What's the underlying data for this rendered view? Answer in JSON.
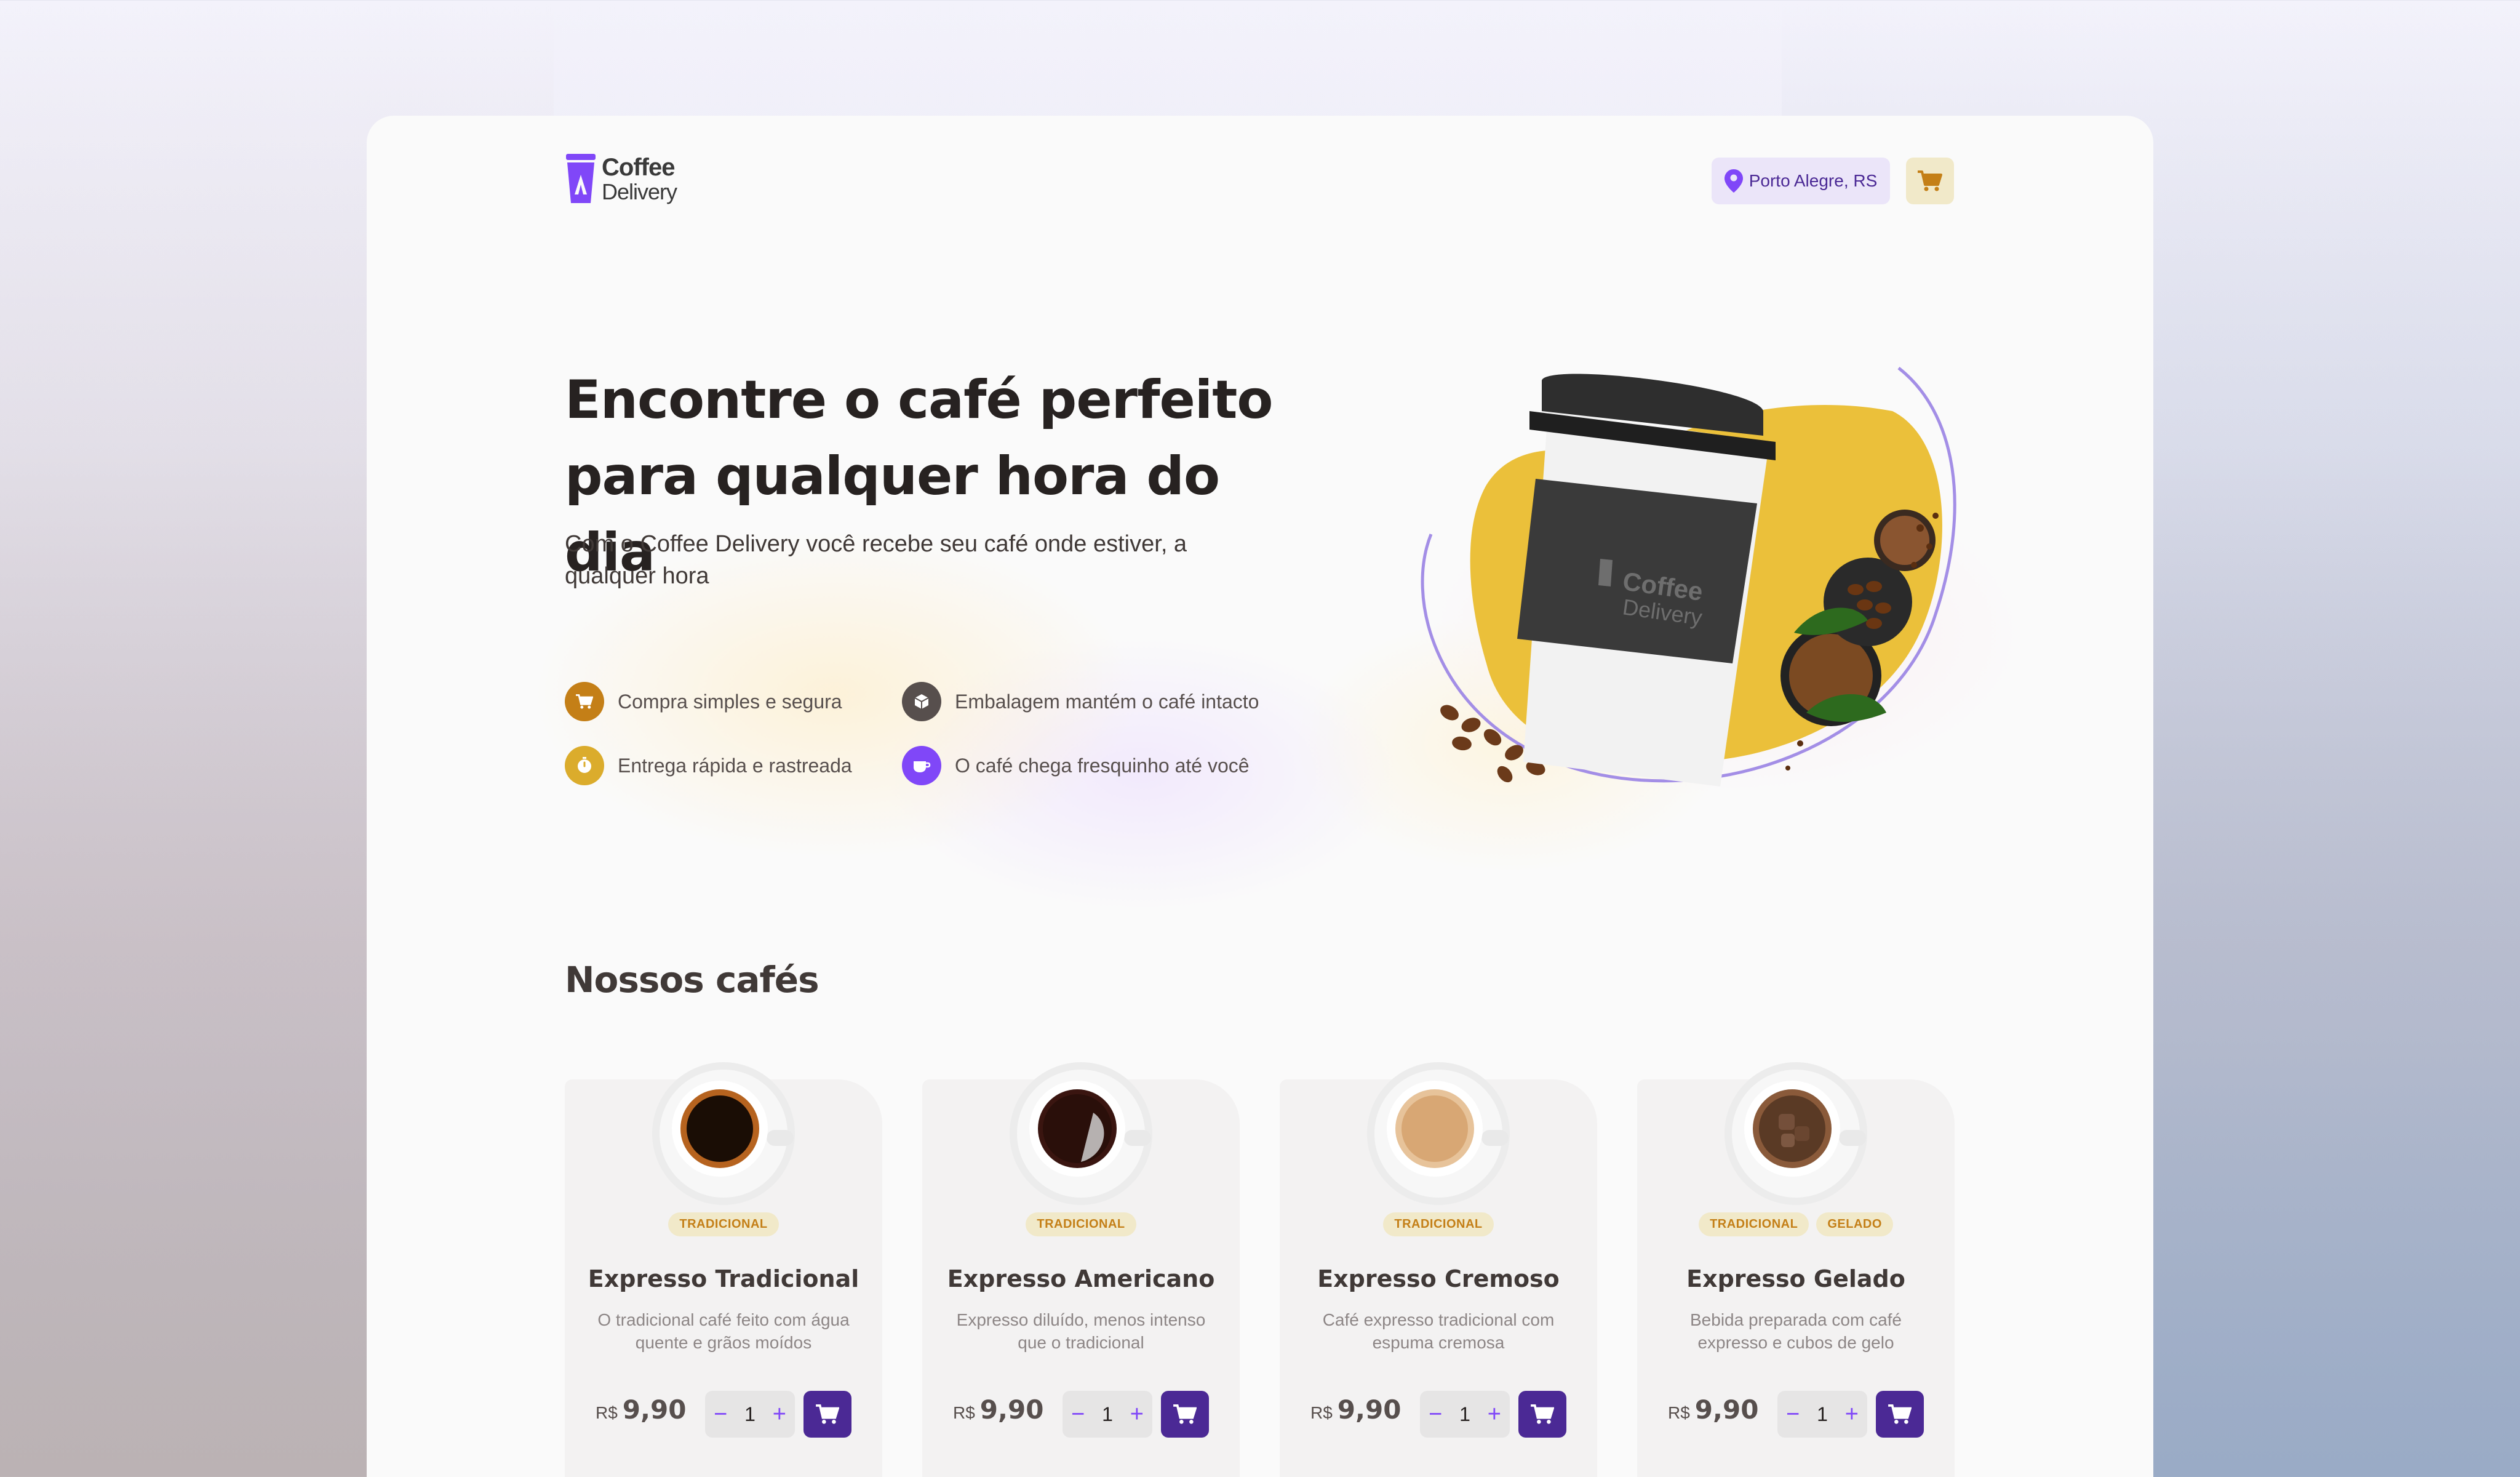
{
  "header": {
    "logo_line1": "Coffee",
    "logo_line2": "Delivery",
    "location": "Porto Alegre, RS"
  },
  "hero": {
    "title_line1": "Encontre o café perfeito",
    "title_line2": "para qualquer hora do dia",
    "subtitle": "Com o Coffee Delivery você recebe seu café onde estiver, a qualquer hora",
    "features": [
      {
        "label": "Compra simples e segura",
        "icon": "cart-icon",
        "color": "#c47f17"
      },
      {
        "label": "Embalagem mantém o café intacto",
        "icon": "package-icon",
        "color": "#574f4d"
      },
      {
        "label": "Entrega rápida e rastreada",
        "icon": "timer-icon",
        "color": "#dbac2c"
      },
      {
        "label": "O café chega fresquinho até você",
        "icon": "coffee-icon",
        "color": "#8047f8"
      }
    ],
    "cup_brand_line1": "Coffee",
    "cup_brand_line2": "Delivery"
  },
  "section": {
    "title": "Nossos cafés"
  },
  "products": [
    {
      "tags": [
        "TRADICIONAL"
      ],
      "name": "Expresso Tradicional",
      "desc": "O tradicional café feito com água quente e grãos moídos",
      "currency": "R$",
      "price": "9,90",
      "qty": "1",
      "coffee_color": "#1a0d05"
    },
    {
      "tags": [
        "TRADICIONAL"
      ],
      "name": "Expresso Americano",
      "desc": "Expresso diluído, menos intenso que o tradicional",
      "currency": "R$",
      "price": "9,90",
      "qty": "1",
      "coffee_color": "#2a0f0a"
    },
    {
      "tags": [
        "TRADICIONAL"
      ],
      "name": "Expresso Cremoso",
      "desc": "Café expresso tradicional com espuma cremosa",
      "currency": "R$",
      "price": "9,90",
      "qty": "1",
      "coffee_color": "#d8a774"
    },
    {
      "tags": [
        "TRADICIONAL",
        "GELADO"
      ],
      "name": "Expresso Gelado",
      "desc": "Bebida preparada com café expresso e cubos de gelo",
      "currency": "R$",
      "price": "9,90",
      "qty": "1",
      "coffee_color": "#5a3a25"
    }
  ],
  "colors": {
    "purple_dark": "#4b2995",
    "purple": "#8047f8",
    "yellow": "#dbac2c",
    "yellow_dark": "#c47f17",
    "yellow_light": "#f1e9c9"
  }
}
